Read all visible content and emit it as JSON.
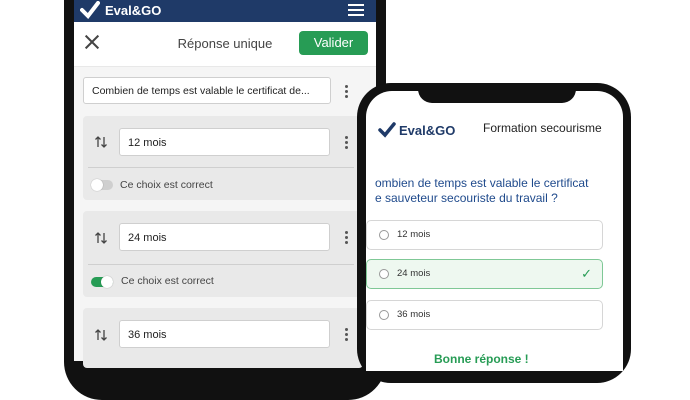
{
  "brand": "Eval&GO",
  "colors": {
    "navy": "#1f3a68",
    "green": "#279c55"
  },
  "editor": {
    "title": "Réponse unique",
    "validate_label": "Valider",
    "question_text": "Combien de temps est valable le certificat de...",
    "answers": [
      {
        "value": "12 mois",
        "correct_label": "Ce choix est correct",
        "correct": false
      },
      {
        "value": "24 mois",
        "correct_label": "Ce choix est correct",
        "correct": true
      },
      {
        "value": "36 mois"
      }
    ]
  },
  "preview": {
    "title": "Formation secourisme",
    "question_line1": "ombien de temps est valable le certificat",
    "question_line2": "e sauveteur secouriste du travail ?",
    "options": [
      {
        "label": "12 mois",
        "selected": false
      },
      {
        "label": "24 mois",
        "selected": true
      },
      {
        "label": "36 mois",
        "selected": false
      }
    ],
    "feedback": "Bonne réponse !"
  }
}
